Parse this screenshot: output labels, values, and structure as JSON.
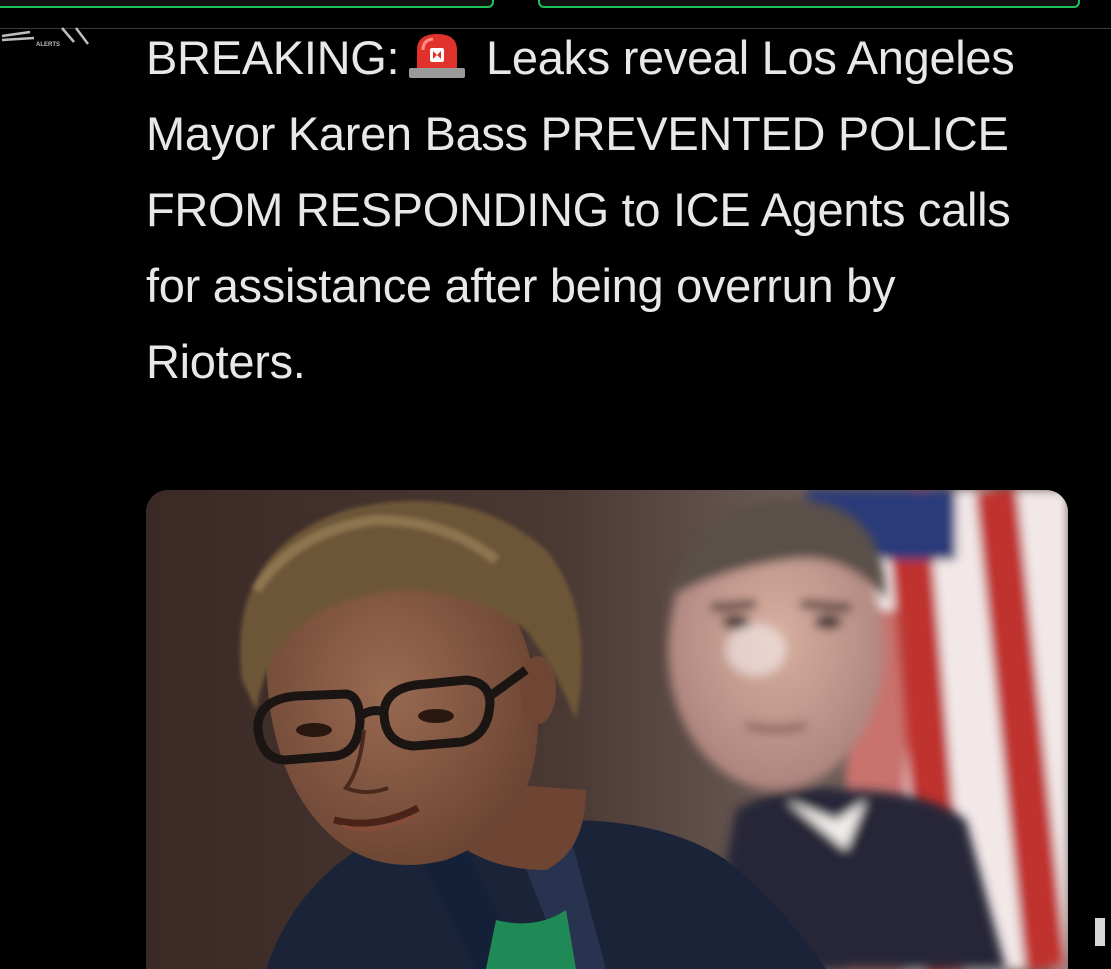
{
  "post": {
    "label_breaking": "BREAKING:",
    "siren_icon": "rotating-light-emoji",
    "text_rest": " Leaks reveal Los Angeles Mayor Karen Bass PREVENTED POLICE FROM RESPONDING to ICE Agents calls for assistance after being overrun by Rioters."
  },
  "source_logo_text": "ALERTS",
  "colors": {
    "background": "#000000",
    "text": "#e8e8e8",
    "accent_green": "#20c35a",
    "siren_red": "#e0312c"
  }
}
